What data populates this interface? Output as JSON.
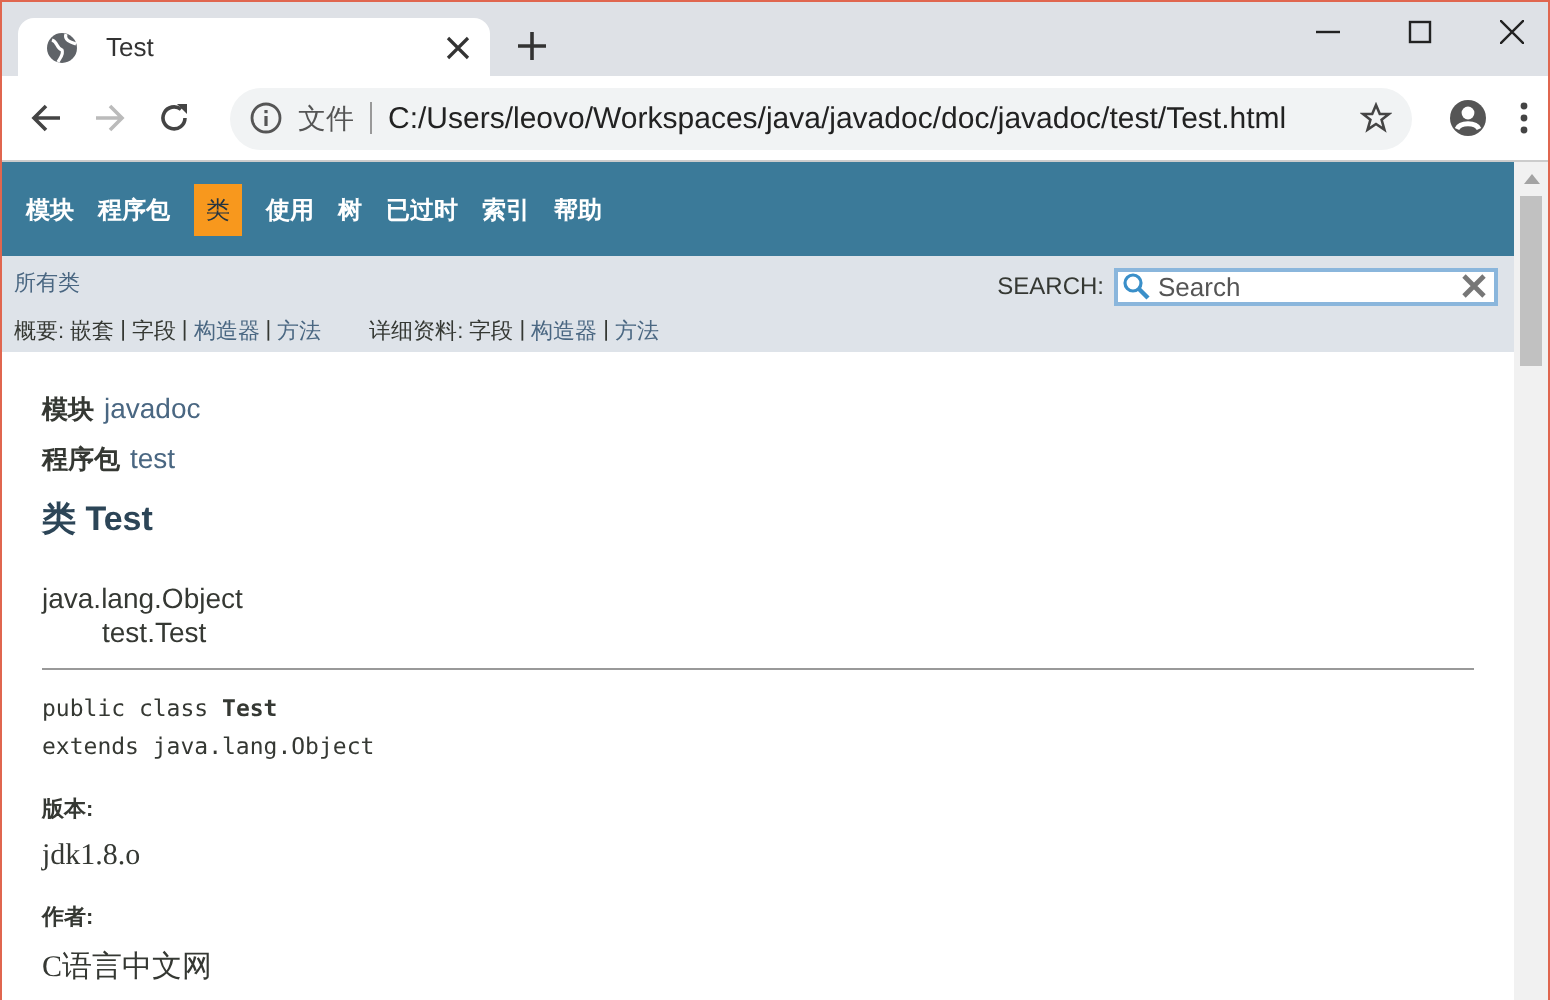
{
  "browser": {
    "tab": {
      "title": "Test"
    },
    "address": {
      "scheme_label": "文件",
      "url": "C:/Users/leovo/Workspaces/java/javadoc/doc/javadoc/test/Test.html"
    }
  },
  "nav": [
    {
      "label": "模块",
      "selected": false
    },
    {
      "label": "程序包",
      "selected": false
    },
    {
      "label": "类",
      "selected": true
    },
    {
      "label": "使用",
      "selected": false
    },
    {
      "label": "树",
      "selected": false
    },
    {
      "label": "已过时",
      "selected": false
    },
    {
      "label": "索引",
      "selected": false
    },
    {
      "label": "帮助",
      "selected": false
    }
  ],
  "subnav": {
    "all_classes": "所有类",
    "search_label": "SEARCH:",
    "search_placeholder": "Search",
    "summary": {
      "label": "概要:",
      "separator": "|",
      "items": [
        {
          "text": "嵌套",
          "link": false
        },
        {
          "text": "字段",
          "link": false
        },
        {
          "text": "构造器",
          "link": true
        },
        {
          "text": "方法",
          "link": true
        }
      ]
    },
    "detail": {
      "label": "详细资料:",
      "separator": "|",
      "items": [
        {
          "text": "字段",
          "link": false
        },
        {
          "text": "构造器",
          "link": true
        },
        {
          "text": "方法",
          "link": true
        }
      ]
    }
  },
  "content": {
    "module": {
      "label": "模块",
      "value": "javadoc"
    },
    "package": {
      "label": "程序包",
      "value": "test"
    },
    "title": "类 Test",
    "hierarchy": [
      "java.lang.Object",
      "test.Test"
    ],
    "signature": [
      "public class **Test**",
      "extends java.lang.Object"
    ],
    "tags": [
      {
        "label": "版本:",
        "value": "jdk1.8.o"
      },
      {
        "label": "作者:",
        "value": "C语言中文网"
      }
    ]
  }
}
